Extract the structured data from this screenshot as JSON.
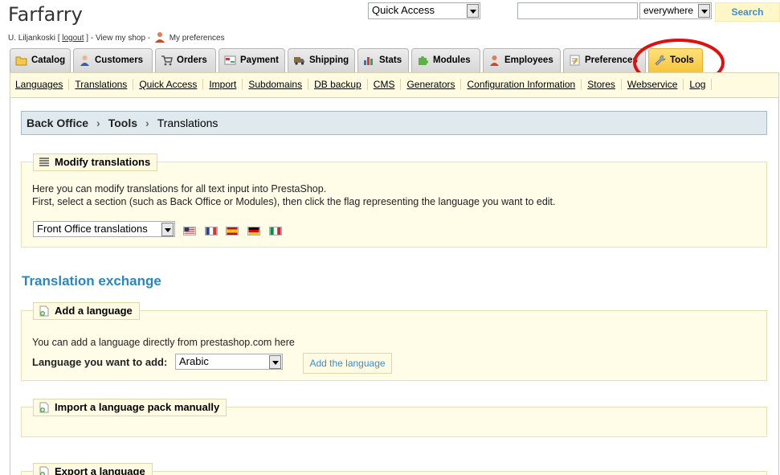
{
  "header": {
    "shop_name": "Farfarry",
    "user_prefix": "U. Liljankoski [",
    "logout_label": "logout",
    "user_suffix": "] - View my shop -",
    "preferences_label": "My preferences",
    "quick_access_label": "Quick Access",
    "search_value": "",
    "search_scope": "everywhere",
    "search_button": "Search"
  },
  "tabs": [
    {
      "label": "Catalog",
      "icon": "folder-icon",
      "active": false
    },
    {
      "label": "Customers",
      "icon": "customer-icon",
      "active": false
    },
    {
      "label": "Orders",
      "icon": "cart-icon",
      "active": false
    },
    {
      "label": "Payment",
      "icon": "payment-icon",
      "active": false
    },
    {
      "label": "Shipping",
      "icon": "truck-icon",
      "active": false
    },
    {
      "label": "Stats",
      "icon": "chart-icon",
      "active": false
    },
    {
      "label": "Modules",
      "icon": "puzzle-icon",
      "active": false
    },
    {
      "label": "Employees",
      "icon": "employee-icon",
      "active": false
    },
    {
      "label": "Preferences",
      "icon": "preferences-icon",
      "active": false
    },
    {
      "label": "Tools",
      "icon": "wrench-icon",
      "active": true
    }
  ],
  "subnav": [
    "Languages",
    "Translations",
    "Quick Access",
    "Import",
    "Subdomains",
    "DB backup",
    "CMS",
    "Generators",
    "Configuration Information",
    "Stores",
    "Webservice",
    "Log"
  ],
  "breadcrumb": {
    "root": "Back Office",
    "section": "Tools",
    "current": "Translations"
  },
  "modify": {
    "legend": "Modify translations",
    "line1": "Here you can modify translations for all text input into PrestaShop.",
    "line2": "First, select a section (such as Back Office or Modules), then click the flag representing the language you want to edit.",
    "select_value": "Front Office translations",
    "flags": [
      "en-flag-icon",
      "fr-flag-icon",
      "es-flag-icon",
      "de-flag-icon",
      "it-flag-icon"
    ]
  },
  "exchange_title": "Translation exchange",
  "add_language": {
    "legend": "Add a language",
    "description": "You can add a language directly from prestashop.com here",
    "label": "Language you want to add:",
    "select_value": "Arabic",
    "button": "Add the language"
  },
  "import_language": {
    "legend": "Import a language pack manually"
  },
  "export_language": {
    "legend": "Export a language"
  },
  "colors": {
    "accent": "#2a86c0",
    "active_tab": "#f6c43c",
    "panel_bg": "#fffde8",
    "highlight_circle": "#e01010"
  }
}
